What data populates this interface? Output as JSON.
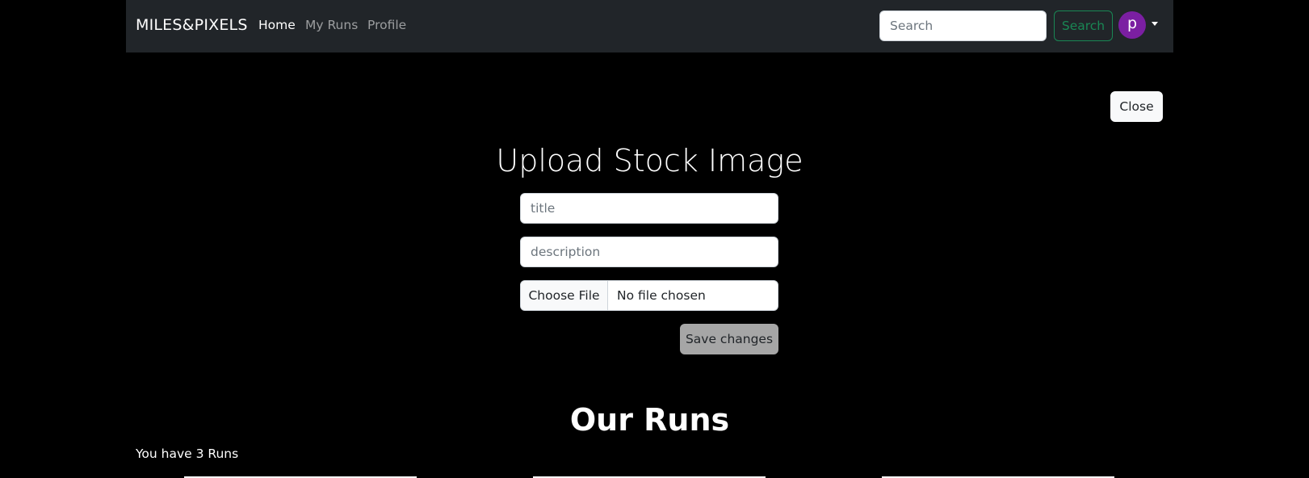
{
  "navbar": {
    "brand": "MILES&PIXELS",
    "links": [
      {
        "label": "Home",
        "active": true
      },
      {
        "label": "My Runs",
        "active": false
      },
      {
        "label": "Profile",
        "active": false
      }
    ],
    "search": {
      "placeholder": "Search",
      "button_label": "Search"
    },
    "user": {
      "avatar_letter": "p",
      "avatar_color": "#7b1fa2"
    }
  },
  "modal": {
    "close_label": "Close",
    "title": "Upload Stock Image",
    "fields": {
      "title_placeholder": "title",
      "description_placeholder": "description"
    },
    "file": {
      "button_label": "Choose File",
      "status": "No file chosen"
    },
    "save_label": "Save changes"
  },
  "runs": {
    "heading": "Our Runs",
    "count_text": "You have 3 Runs"
  },
  "colors": {
    "navbar_bg": "#212529",
    "page_bg": "#000000",
    "success": "#198754",
    "save_button_bg": "#a6a6a6"
  }
}
